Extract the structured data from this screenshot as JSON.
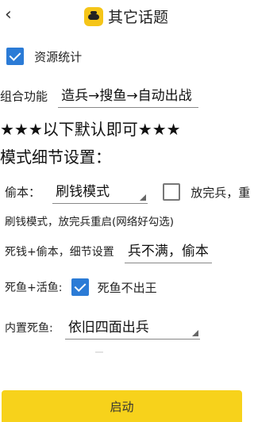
{
  "header": {
    "title": "其它话题",
    "back_icon": "chevron-left-icon",
    "app_icon": "bee-icon"
  },
  "resource_stats": {
    "label": "资源统计",
    "checked": true
  },
  "combo": {
    "label": "组合功能",
    "value": "造兵→搜鱼→自动出战"
  },
  "stars_note": "★★★以下默认即可★★★",
  "mode_header": "模式细节设置：",
  "steal": {
    "label": "偷本：",
    "value": "刷钱模式",
    "restart_checkbox": {
      "label": "放完兵，重",
      "checked": false
    }
  },
  "note_line": "刷钱模式，放完兵重启(网络好勾选)",
  "dead_money": {
    "label": "死钱+偷本，细节设置",
    "value": "兵不满，偷本"
  },
  "dead_fish": {
    "label": "死鱼+活鱼:",
    "checkbox_label": "死鱼不出王",
    "checked": true
  },
  "builtin_dead": {
    "label": "内置死鱼:",
    "value": "依旧四面出兵"
  },
  "start_button": {
    "label": "启动"
  },
  "colors": {
    "accent": "#f7d21b",
    "checkbox": "#2b7bd6"
  }
}
